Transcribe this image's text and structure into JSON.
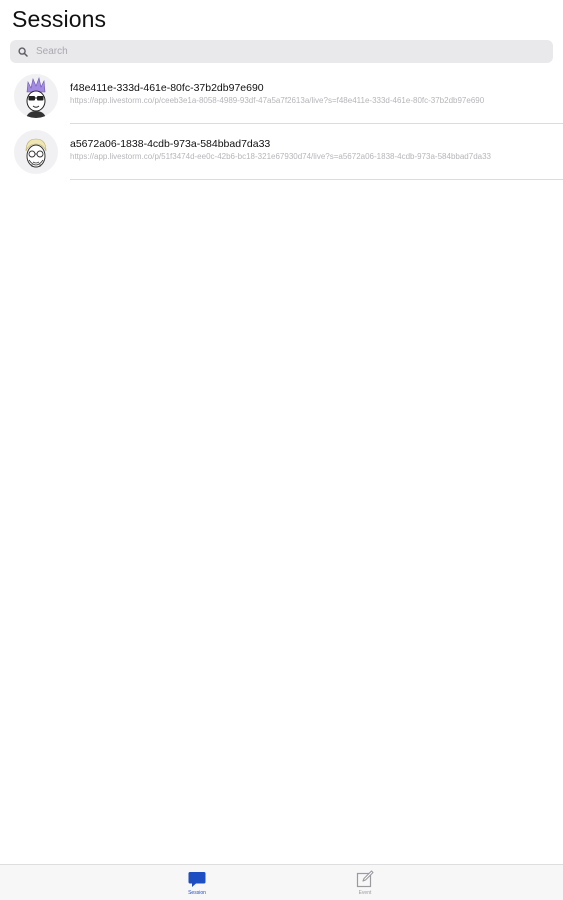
{
  "header": {
    "title": "Sessions"
  },
  "search": {
    "placeholder": "Search",
    "value": ""
  },
  "sessions": [
    {
      "id": "f48e411e-333d-461e-80fc-37b2db97e690",
      "url": "https://app.livestorm.co/p/ceeb3e1a-8058-4989-93df-47a5a7f2613a/live?s=f48e411e-333d-461e-80fc-37b2db97e690",
      "avatar": "purple-hair-avatar-icon"
    },
    {
      "id": "a5672a06-1838-4cdb-973a-584bbad7da33",
      "url": "https://app.livestorm.co/p/51f3474d-ee0c-42b6-bc18-321e67930d74/live?s=a5672a06-1838-4cdb-973a-584bbad7da33",
      "avatar": "blonde-hair-avatar-icon"
    }
  ],
  "tabs": [
    {
      "label": "Session",
      "icon": "chat-bubble-icon",
      "active": true
    },
    {
      "label": "Event",
      "icon": "edit-icon",
      "active": false
    }
  ],
  "colors": {
    "accent": "#1e4fc2",
    "inactive": "#9a9aa0",
    "search_bg": "#e9e9ec",
    "avatar1_hair": "#a38be3",
    "avatar2_hair": "#e8dc9a"
  }
}
